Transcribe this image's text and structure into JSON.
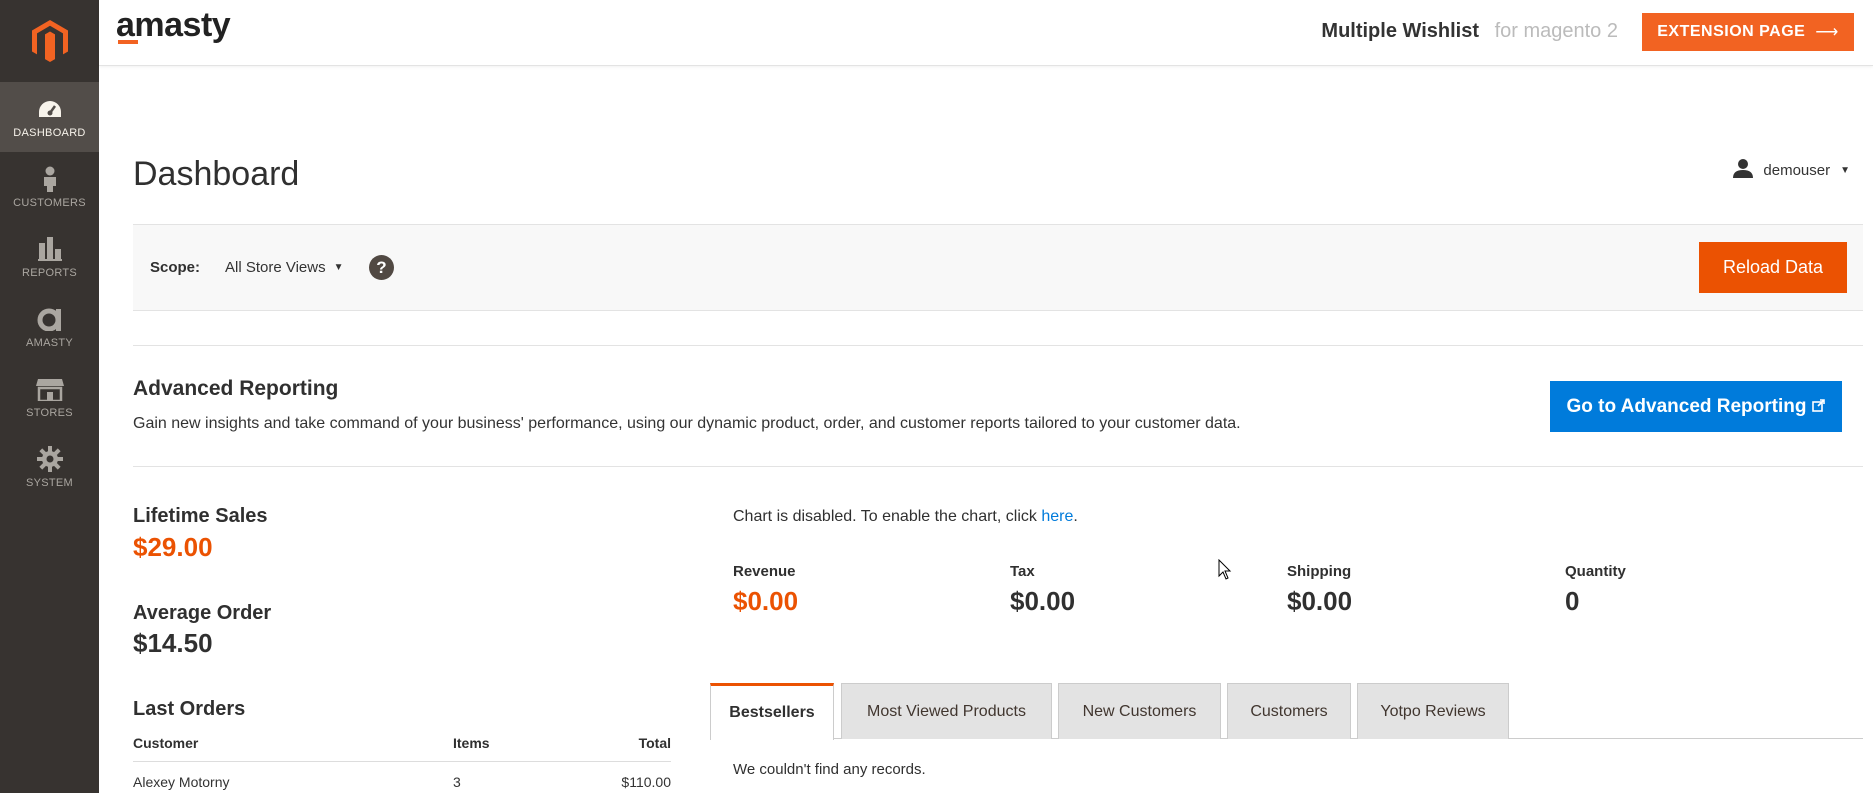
{
  "sidebar": {
    "items": [
      {
        "label": "DASHBOARD",
        "icon": "dashboard-icon"
      },
      {
        "label": "CUSTOMERS",
        "icon": "customers-icon"
      },
      {
        "label": "REPORTS",
        "icon": "reports-icon"
      },
      {
        "label": "AMASTY",
        "icon": "amasty-icon"
      },
      {
        "label": "STORES",
        "icon": "stores-icon"
      },
      {
        "label": "SYSTEM",
        "icon": "gear-icon"
      }
    ]
  },
  "banner": {
    "brand": "amasty",
    "extension_name": "Multiple Wishlist",
    "extension_for": "for magento 2",
    "extension_button": "EXTENSION PAGE",
    "arrow": "⟶"
  },
  "header": {
    "title": "Dashboard",
    "user": "demouser"
  },
  "scope": {
    "label": "Scope:",
    "selected": "All Store Views",
    "help": "?",
    "reload_button": "Reload Data"
  },
  "advanced": {
    "title": "Advanced Reporting",
    "description": "Gain new insights and take command of your business' performance, using our dynamic product, order, and customer reports tailored to your customer data.",
    "button": "Go to Advanced Reporting"
  },
  "stats": {
    "lifetime_label": "Lifetime Sales",
    "lifetime_value": "$29.00",
    "average_label": "Average Order",
    "average_value": "$14.50"
  },
  "last_orders": {
    "title": "Last Orders",
    "columns": [
      "Customer",
      "Items",
      "Total"
    ],
    "rows": [
      {
        "customer": "Alexey Motorny",
        "items": "3",
        "total": "$110.00"
      }
    ]
  },
  "chart": {
    "message_prefix": "Chart is disabled. To enable the chart, click ",
    "link": "here",
    "message_suffix": "."
  },
  "totals": [
    {
      "label": "Revenue",
      "value": "$0.00"
    },
    {
      "label": "Tax",
      "value": "$0.00"
    },
    {
      "label": "Shipping",
      "value": "$0.00"
    },
    {
      "label": "Quantity",
      "value": "0"
    }
  ],
  "tabs": {
    "items": [
      "Bestsellers",
      "Most Viewed Products",
      "New Customers",
      "Customers",
      "Yotpo Reviews"
    ],
    "active": "Bestsellers",
    "empty_message": "We couldn't find any records."
  },
  "colors": {
    "accent": "#eb5202",
    "link": "#007bdb",
    "sidebar": "#373330"
  }
}
